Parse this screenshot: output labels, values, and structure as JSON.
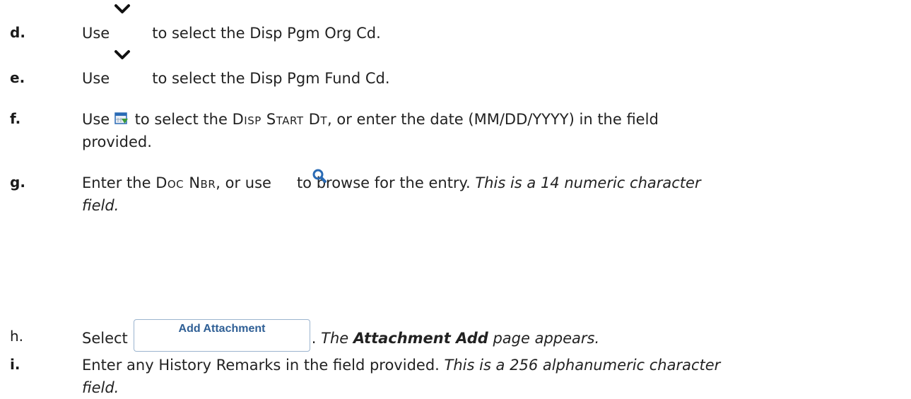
{
  "steps": [
    {
      "letter": "d.",
      "use": "Use",
      "rest": "to select the Disp Pgm Org Cd.",
      "icon": "chevron-down-icon"
    },
    {
      "letter": "e.",
      "use": "Use",
      "rest": "to select the Disp Pgm Fund Cd.",
      "icon": "chevron-down-icon"
    },
    {
      "letter": "f.",
      "use": "Use",
      "pre": "to select the",
      "field": "Disp Start Dt",
      "post": ", or enter the date (MM/DD/YYYY) in the field",
      "line2": "provided.",
      "icon": "calendar-icon"
    },
    {
      "letter": "g.",
      "pre": "Enter the",
      "field": "Doc Nbr",
      "mid": ", or use",
      "rest": "to browse for the entry.",
      "note1": "This is a 14 numeric character",
      "note2": "field.",
      "icon": "search-icon"
    },
    {
      "letter": "h.",
      "pre": "Select",
      "button": "Add Attachment",
      "dot": ".",
      "note_pre": "The",
      "note_bold": "Attachment Add",
      "note_post": "page appears."
    },
    {
      "letter": "i.",
      "text": "Enter any History Remarks in the field provided.",
      "note1": "This is a 256 alphanumeric character",
      "note2": "field."
    }
  ],
  "colors": {
    "text": "#222222",
    "button_text": "#2f5f95",
    "button_border": "#9bb4cf",
    "icon_blue": "#2a6bb5"
  }
}
